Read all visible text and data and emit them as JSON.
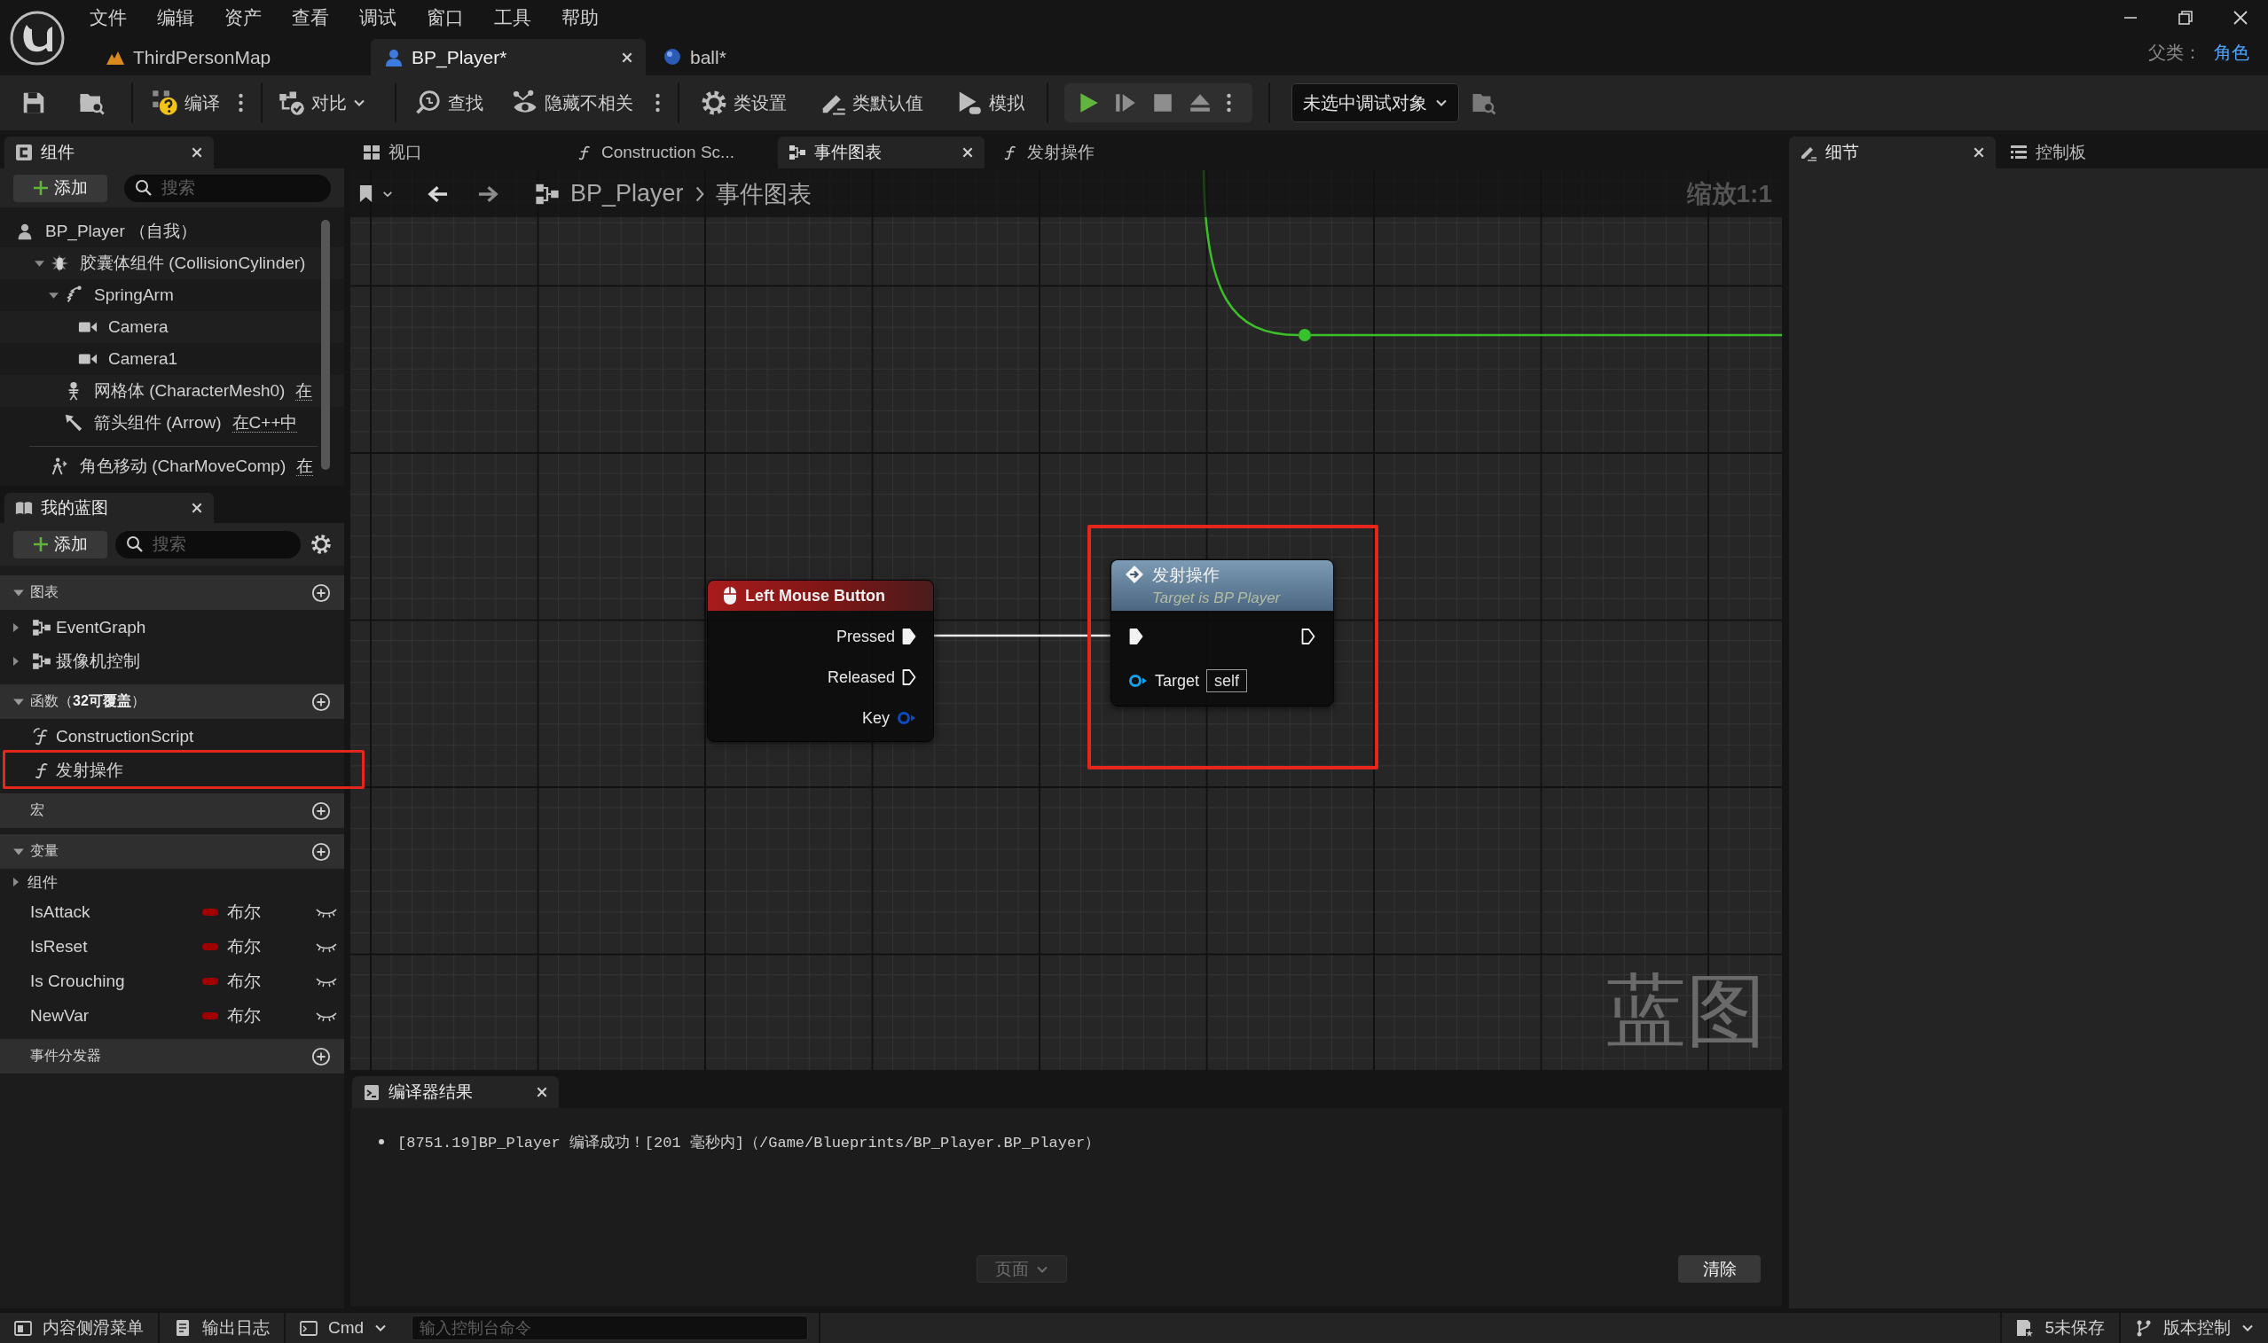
{
  "window": {
    "menu": [
      "文件",
      "编辑",
      "资产",
      "查看",
      "调试",
      "窗口",
      "工具",
      "帮助"
    ],
    "document_tabs": [
      {
        "label": "ThirdPersonMap",
        "kind": "level",
        "selected": false
      },
      {
        "label": "BP_Player*",
        "kind": "character",
        "selected": true
      },
      {
        "label": "ball*",
        "kind": "sphere",
        "selected": false
      }
    ],
    "parent_class": {
      "label": "父类：",
      "value": "角色"
    }
  },
  "toolbar": {
    "compile": "编译",
    "diff": "对比",
    "find": "查找",
    "hide_unrelated": "隐藏不相关",
    "class_settings": "类设置",
    "class_defaults": "类默认值",
    "simulate": "模拟",
    "debug_object": "未选中调试对象"
  },
  "components_panel": {
    "tab": {
      "label": "组件",
      "selected": true
    },
    "add_button": "添加",
    "search": {
      "placeholder": "搜索"
    },
    "tree": [
      {
        "name": "BP_Player （自我）",
        "kind": "actor",
        "children": [
          {
            "name": "胶囊体组件 (CollisionCylinder)",
            "kind": "capsule",
            "expanded": true,
            "children": [
              {
                "name": "SpringArm",
                "kind": "spring_arm",
                "expanded": true,
                "children": [
                  {
                    "name": "Camera",
                    "kind": "camera"
                  },
                  {
                    "name": "Camera1",
                    "kind": "camera"
                  }
                ]
              },
              {
                "name": "网格体 (CharacterMesh0)",
                "kind": "mesh",
                "note": "在"
              },
              {
                "name": "箭头组件 (Arrow)",
                "kind": "arrow",
                "note": "在C++中"
              }
            ]
          }
        ]
      }
    ],
    "actor_components": [
      {
        "name": "角色移动 (CharMoveComp)",
        "kind": "movement",
        "note": "在"
      }
    ]
  },
  "my_blueprint": {
    "tab": {
      "label": "我的蓝图",
      "selected": true
    },
    "add_button": "添加",
    "search": {
      "placeholder": "搜索"
    },
    "sections": [
      {
        "title": "图表",
        "expanded": true,
        "items": [
          {
            "label": "EventGraph",
            "kind": "graph",
            "expanded": false,
            "highlighted": false
          },
          {
            "label": "摄像机控制",
            "kind": "graph",
            "expanded": false,
            "highlighted": false
          }
        ]
      },
      {
        "title": "函数（**32可覆盖**）",
        "expanded": true,
        "items": [
          {
            "label": "ConstructionScript",
            "kind": "construction",
            "highlighted": false
          },
          {
            "label": "发射操作",
            "kind": "function",
            "highlighted": true
          }
        ]
      },
      {
        "title": "宏"
      },
      {
        "title": "变量",
        "expanded": true,
        "categories": [
          {
            "label": "组件",
            "expanded": false
          }
        ],
        "variables": [
          {
            "name": "IsAttack",
            "type": "布尔",
            "color": "#a00000",
            "exposed": false
          },
          {
            "name": "IsReset",
            "type": "布尔",
            "color": "#a00000",
            "exposed": false
          },
          {
            "name": "Is Crouching",
            "type": "布尔",
            "color": "#a00000",
            "exposed": false
          },
          {
            "name": "NewVar",
            "type": "布尔",
            "color": "#a00000",
            "exposed": false
          }
        ]
      },
      {
        "title": "事件分发器"
      }
    ]
  },
  "graph": {
    "tabs": [
      {
        "label": "视口",
        "kind": "viewport",
        "selected": false
      },
      {
        "label": "Construction Sc...",
        "kind": "function",
        "selected": false
      },
      {
        "label": "事件图表",
        "kind": "graph",
        "selected": true
      },
      {
        "label": "发射操作",
        "kind": "function",
        "selected": false
      }
    ],
    "breadcrumb": [
      "BP_Player",
      "事件图表"
    ],
    "zoom": "缩放1:1",
    "watermark": "蓝图",
    "nodes": [
      {
        "kind": "event",
        "title": "Left Mouse Button",
        "highlighted": false,
        "outputs": [
          {
            "label": "Pressed",
            "kind": "exec",
            "connected": true
          },
          {
            "label": "Released",
            "kind": "exec",
            "connected": false
          },
          {
            "label": "Key",
            "kind": "struct",
            "connected": false
          }
        ]
      },
      {
        "kind": "function",
        "title": "发射操作",
        "subtitle": "Target is BP Player",
        "highlighted": true,
        "exec_in": {
          "connected": true
        },
        "exec_out": {
          "connected": false
        },
        "inputs": [
          {
            "label": "Target",
            "kind": "object",
            "value": "self",
            "connected": false
          }
        ]
      }
    ]
  },
  "compiler_results": {
    "tab": {
      "label": "编译器结果",
      "selected": true
    },
    "messages": [
      "[8751.19]BP_Player 编译成功！[201 毫秒内]（/Game/Blueprints/BP_Player.BP_Player）"
    ],
    "page_button": {
      "label": "页面",
      "disabled": true
    },
    "clear_button": "清除"
  },
  "details_panel": {
    "tabs": [
      {
        "label": "细节",
        "kind": "details",
        "selected": true
      },
      {
        "label": "控制板",
        "kind": "palette",
        "selected": false
      }
    ]
  },
  "status_bar": {
    "content_drawer": "内容侧滑菜单",
    "output_log": "输出日志",
    "cmd": "Cmd",
    "console": {
      "placeholder": "输入控制台命令"
    },
    "unsaved": "5未保存",
    "source_control": "版本控制"
  }
}
